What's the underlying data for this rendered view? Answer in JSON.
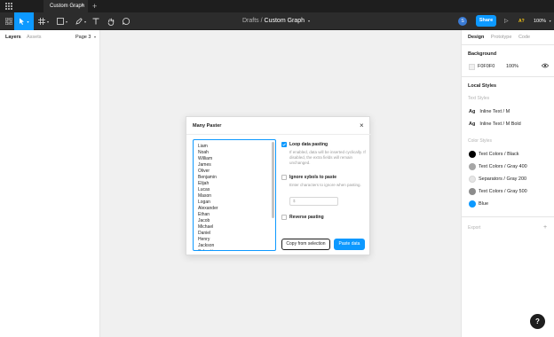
{
  "tabbar": {
    "file_tab": "Custom Graph",
    "close": "×",
    "new_tab": "+"
  },
  "toolbar": {
    "breadcrumb_project": "Drafts",
    "breadcrumb_sep": "/",
    "breadcrumb_file": "Custom Graph",
    "avatar_initial": "S",
    "share_label": "Share",
    "aa_label": "A?",
    "zoom_label": "100%"
  },
  "left_panel": {
    "tab_layers": "Layers",
    "tab_assets": "Assets",
    "page_label": "Page 3"
  },
  "right_panel": {
    "tabs": [
      "Design",
      "Prototype",
      "Code"
    ],
    "background": {
      "heading": "Background",
      "hex": "F0F0F0",
      "opacity": "100%"
    },
    "local_styles": {
      "heading": "Local Styles",
      "text_styles_label": "Text Styles",
      "text_styles": [
        {
          "ag": "Ag",
          "name": "Inline Text / M"
        },
        {
          "ag": "Ag",
          "name": "Inline Text / M Bold"
        }
      ],
      "color_styles_label": "Color Styles",
      "color_styles": [
        {
          "name": "Text Colors / Black",
          "color": "#000000"
        },
        {
          "name": "Text Colors / Gray 400",
          "color": "#a6a6a6"
        },
        {
          "name": "Separators / Gray 200",
          "color": "#e6e6e6"
        },
        {
          "name": "Text Colors / Gray 500",
          "color": "#8c8c8c"
        },
        {
          "name": "Blue",
          "color": "#0d99ff"
        }
      ]
    },
    "export_heading": "Export"
  },
  "dialog": {
    "title": "Many Paster",
    "close": "×",
    "names": [
      "Liam",
      "Noah",
      "William",
      "James",
      "Oliver",
      "Benjamin",
      "Elijah",
      "Lucas",
      "Mason",
      "Logan",
      "Alexander",
      "Ethan",
      "Jacob",
      "Michael",
      "Daniel",
      "Henry",
      "Jackson",
      "Sebastian"
    ],
    "loop": {
      "label": "Loop data pasting",
      "checked": true,
      "desc": "If enabled, data will be inserted cyclically. If disabled, the extra fields will remain unchanged."
    },
    "ignore": {
      "label": "Ignore sybols to paste",
      "checked": false,
      "desc": "Enter characters to ignore when pasting.",
      "input_value": "$"
    },
    "reverse": {
      "label": "Reverse pasting",
      "checked": false
    },
    "copy_button": "Copy from selection",
    "paste_button": "Paste data"
  },
  "help_label": "?"
}
